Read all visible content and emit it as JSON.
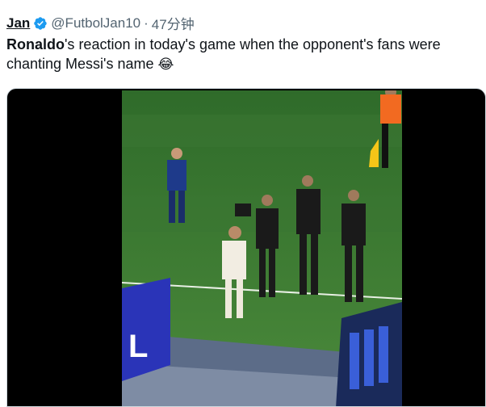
{
  "tweet": {
    "display_name": "Jan",
    "handle": "@FutbolJan10",
    "separator": "·",
    "time": "47分钟",
    "text_bold": "Ronaldo",
    "text_rest": "'s reaction in today's game when the opponent's fans were chanting Messi's name",
    "emoji": "😂"
  },
  "icons": {
    "verified": "verified-badge-icon"
  },
  "colors": {
    "verified_blue": "#1d9bf0",
    "pitch_green": "#3f7a33",
    "text_primary": "#0f1419",
    "text_secondary": "#536471"
  }
}
